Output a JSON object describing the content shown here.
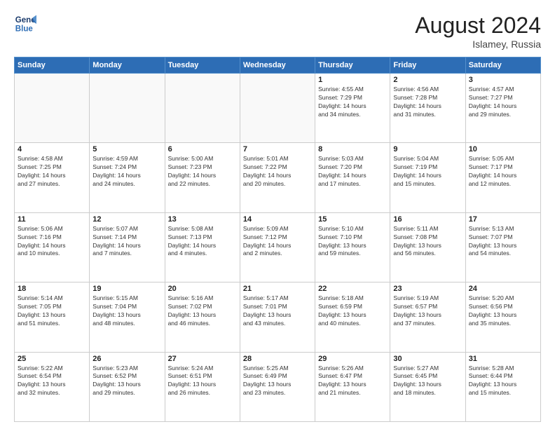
{
  "header": {
    "logo_line1": "General",
    "logo_line2": "Blue",
    "month_year": "August 2024",
    "location": "Islamey, Russia"
  },
  "weekdays": [
    "Sunday",
    "Monday",
    "Tuesday",
    "Wednesday",
    "Thursday",
    "Friday",
    "Saturday"
  ],
  "weeks": [
    [
      {
        "day": "",
        "empty": true
      },
      {
        "day": "",
        "empty": true
      },
      {
        "day": "",
        "empty": true
      },
      {
        "day": "",
        "empty": true
      },
      {
        "day": "1",
        "info": "Sunrise: 4:55 AM\nSunset: 7:29 PM\nDaylight: 14 hours\nand 34 minutes."
      },
      {
        "day": "2",
        "info": "Sunrise: 4:56 AM\nSunset: 7:28 PM\nDaylight: 14 hours\nand 31 minutes."
      },
      {
        "day": "3",
        "info": "Sunrise: 4:57 AM\nSunset: 7:27 PM\nDaylight: 14 hours\nand 29 minutes."
      }
    ],
    [
      {
        "day": "4",
        "info": "Sunrise: 4:58 AM\nSunset: 7:25 PM\nDaylight: 14 hours\nand 27 minutes."
      },
      {
        "day": "5",
        "info": "Sunrise: 4:59 AM\nSunset: 7:24 PM\nDaylight: 14 hours\nand 24 minutes."
      },
      {
        "day": "6",
        "info": "Sunrise: 5:00 AM\nSunset: 7:23 PM\nDaylight: 14 hours\nand 22 minutes."
      },
      {
        "day": "7",
        "info": "Sunrise: 5:01 AM\nSunset: 7:22 PM\nDaylight: 14 hours\nand 20 minutes."
      },
      {
        "day": "8",
        "info": "Sunrise: 5:03 AM\nSunset: 7:20 PM\nDaylight: 14 hours\nand 17 minutes."
      },
      {
        "day": "9",
        "info": "Sunrise: 5:04 AM\nSunset: 7:19 PM\nDaylight: 14 hours\nand 15 minutes."
      },
      {
        "day": "10",
        "info": "Sunrise: 5:05 AM\nSunset: 7:17 PM\nDaylight: 14 hours\nand 12 minutes."
      }
    ],
    [
      {
        "day": "11",
        "info": "Sunrise: 5:06 AM\nSunset: 7:16 PM\nDaylight: 14 hours\nand 10 minutes."
      },
      {
        "day": "12",
        "info": "Sunrise: 5:07 AM\nSunset: 7:14 PM\nDaylight: 14 hours\nand 7 minutes."
      },
      {
        "day": "13",
        "info": "Sunrise: 5:08 AM\nSunset: 7:13 PM\nDaylight: 14 hours\nand 4 minutes."
      },
      {
        "day": "14",
        "info": "Sunrise: 5:09 AM\nSunset: 7:12 PM\nDaylight: 14 hours\nand 2 minutes."
      },
      {
        "day": "15",
        "info": "Sunrise: 5:10 AM\nSunset: 7:10 PM\nDaylight: 13 hours\nand 59 minutes."
      },
      {
        "day": "16",
        "info": "Sunrise: 5:11 AM\nSunset: 7:08 PM\nDaylight: 13 hours\nand 56 minutes."
      },
      {
        "day": "17",
        "info": "Sunrise: 5:13 AM\nSunset: 7:07 PM\nDaylight: 13 hours\nand 54 minutes."
      }
    ],
    [
      {
        "day": "18",
        "info": "Sunrise: 5:14 AM\nSunset: 7:05 PM\nDaylight: 13 hours\nand 51 minutes."
      },
      {
        "day": "19",
        "info": "Sunrise: 5:15 AM\nSunset: 7:04 PM\nDaylight: 13 hours\nand 48 minutes."
      },
      {
        "day": "20",
        "info": "Sunrise: 5:16 AM\nSunset: 7:02 PM\nDaylight: 13 hours\nand 46 minutes."
      },
      {
        "day": "21",
        "info": "Sunrise: 5:17 AM\nSunset: 7:01 PM\nDaylight: 13 hours\nand 43 minutes."
      },
      {
        "day": "22",
        "info": "Sunrise: 5:18 AM\nSunset: 6:59 PM\nDaylight: 13 hours\nand 40 minutes."
      },
      {
        "day": "23",
        "info": "Sunrise: 5:19 AM\nSunset: 6:57 PM\nDaylight: 13 hours\nand 37 minutes."
      },
      {
        "day": "24",
        "info": "Sunrise: 5:20 AM\nSunset: 6:56 PM\nDaylight: 13 hours\nand 35 minutes."
      }
    ],
    [
      {
        "day": "25",
        "info": "Sunrise: 5:22 AM\nSunset: 6:54 PM\nDaylight: 13 hours\nand 32 minutes."
      },
      {
        "day": "26",
        "info": "Sunrise: 5:23 AM\nSunset: 6:52 PM\nDaylight: 13 hours\nand 29 minutes."
      },
      {
        "day": "27",
        "info": "Sunrise: 5:24 AM\nSunset: 6:51 PM\nDaylight: 13 hours\nand 26 minutes."
      },
      {
        "day": "28",
        "info": "Sunrise: 5:25 AM\nSunset: 6:49 PM\nDaylight: 13 hours\nand 23 minutes."
      },
      {
        "day": "29",
        "info": "Sunrise: 5:26 AM\nSunset: 6:47 PM\nDaylight: 13 hours\nand 21 minutes."
      },
      {
        "day": "30",
        "info": "Sunrise: 5:27 AM\nSunset: 6:45 PM\nDaylight: 13 hours\nand 18 minutes."
      },
      {
        "day": "31",
        "info": "Sunrise: 5:28 AM\nSunset: 6:44 PM\nDaylight: 13 hours\nand 15 minutes."
      }
    ]
  ]
}
